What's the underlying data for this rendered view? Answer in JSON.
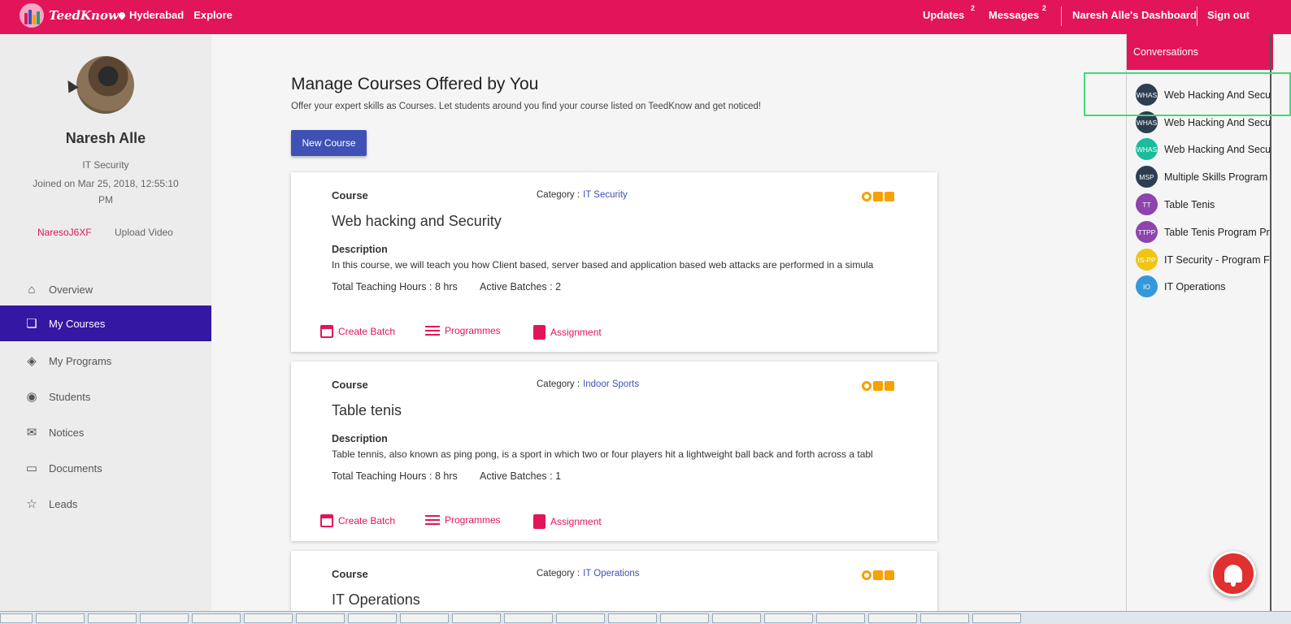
{
  "header": {
    "brand": "TeedKnow",
    "location": "Hyderabad",
    "explore": "Explore",
    "updates": {
      "label": "Updates",
      "count": "2"
    },
    "messages": {
      "label": "Messages",
      "count": "2"
    },
    "dashboard": "Naresh Alle's Dashboard",
    "signout": "Sign out",
    "accent_color": "#e2145a"
  },
  "profile": {
    "name": "Naresh Alle",
    "role": "IT Security",
    "joined": "Joined on Mar 25, 2018, 12:55:10 PM",
    "handle": "NaresoJ6XF",
    "upload_video": "Upload Video"
  },
  "menu": [
    {
      "label": "Overview",
      "icon": "home-icon",
      "active": false
    },
    {
      "label": "My Courses",
      "icon": "book-icon",
      "active": true
    },
    {
      "label": "My Programs",
      "icon": "layers-icon",
      "active": false
    },
    {
      "label": "Students",
      "icon": "user-icon",
      "active": false
    },
    {
      "label": "Notices",
      "icon": "envelope-icon",
      "active": false
    },
    {
      "label": "Documents",
      "icon": "folder-icon",
      "active": false
    },
    {
      "label": "Leads",
      "icon": "star-icon",
      "active": false
    }
  ],
  "main": {
    "title": "Manage Courses Offered by You",
    "subtitle": "Offer your expert skills as Courses. Let students around you find your course listed on TeedKnow and get noticed!",
    "new_course": "New Course",
    "labels": {
      "course": "Course",
      "category": "Category :",
      "description": "Description",
      "hours_prefix": "Total Teaching Hours : ",
      "batches_prefix": "Active Batches : ",
      "create_batch": "Create Batch",
      "programmes": "Programmes",
      "assignment": "Assignment"
    },
    "courses": [
      {
        "name": "Web hacking and Security",
        "category": "IT Security",
        "description": "In this course, we will teach you how Client based, server based and application based web attacks are performed in a simula",
        "hours": "8 hrs",
        "batches": "2"
      },
      {
        "name": "Table tenis",
        "category": "Indoor Sports",
        "description": "Table tennis, also known as ping pong, is a sport in which two or four players hit a lightweight ball back and forth across a tabl",
        "hours": "8 hrs",
        "batches": "1"
      },
      {
        "name": "IT Operations",
        "category": "IT Operations"
      }
    ]
  },
  "conversations": {
    "header": "Conversations",
    "items": [
      {
        "initials": "WHAS",
        "name": "Web Hacking And Secu",
        "color": "#2c3e50"
      },
      {
        "initials": "WHAS",
        "name": "Web Hacking And Secu",
        "color": "#2c3e50"
      },
      {
        "initials": "WHAS",
        "name": "Web Hacking And Secu",
        "color": "#1abc9c"
      },
      {
        "initials": "MSP",
        "name": "Multiple Skills Program",
        "color": "#2c3e50"
      },
      {
        "initials": "TT",
        "name": "Table Tenis",
        "color": "#8e44ad"
      },
      {
        "initials": "TTPP",
        "name": "Table Tenis Program Pr",
        "color": "#8e44ad"
      },
      {
        "initials": "IS-PP",
        "name": "IT Security - Program F",
        "color": "#f1c40f"
      },
      {
        "initials": "IO",
        "name": "IT Operations",
        "color": "#3498db"
      }
    ]
  }
}
